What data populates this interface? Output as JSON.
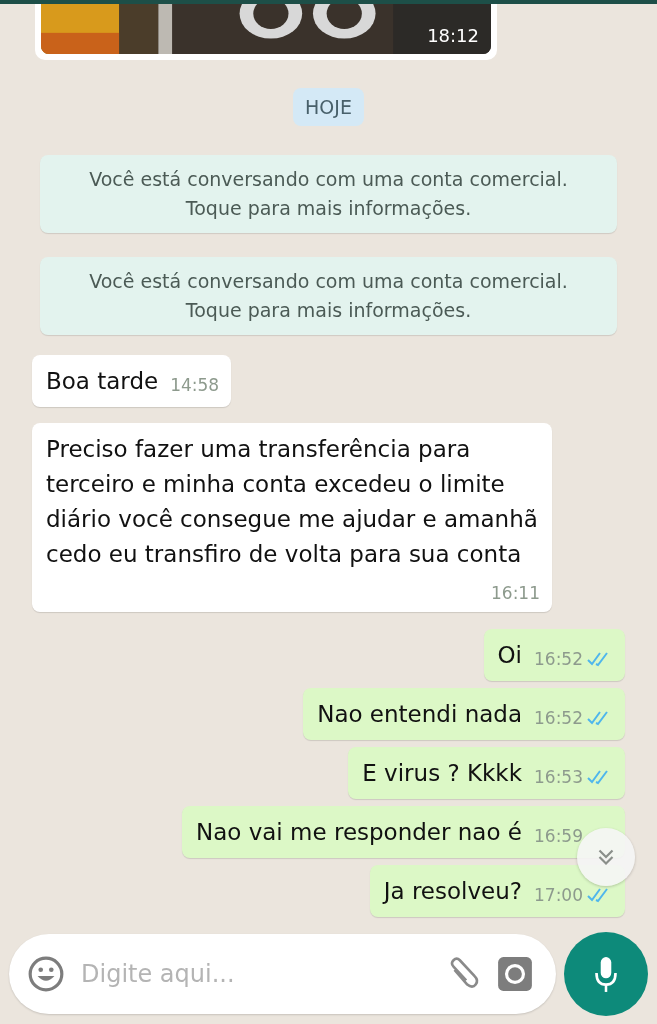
{
  "messages": [
    {
      "time": "18:12"
    },
    {
      "kind": "date",
      "text": "HOJE"
    },
    {
      "kind": "system",
      "text": "Você está conversando com uma conta comercial. Toque para mais informações."
    },
    {
      "kind": "system",
      "text": "Você está conversando com uma conta comercial. Toque para mais informações."
    },
    {
      "kind": "in",
      "text": "Boa tarde",
      "time": "14:58"
    },
    {
      "kind": "in",
      "text": "Preciso fazer uma transferência para terceiro e minha conta excedeu o limite diário você consegue me ajudar e amanhã cedo eu transfiro de volta para sua conta",
      "time": "16:11"
    },
    {
      "kind": "out",
      "text": "Oi",
      "time": "16:52",
      "read": true
    },
    {
      "kind": "out",
      "text": "Nao entendi nada",
      "time": "16:52",
      "read": true
    },
    {
      "kind": "out",
      "text": "E virus ? Kkkk",
      "time": "16:53",
      "read": true
    },
    {
      "kind": "out",
      "text": "Nao vai me responder nao é",
      "time": "16:59"
    },
    {
      "kind": "out",
      "text": "Ja resolveu?",
      "time": "17:00",
      "read": true
    }
  ],
  "composer": {
    "placeholder": "Digite aqui..."
  }
}
